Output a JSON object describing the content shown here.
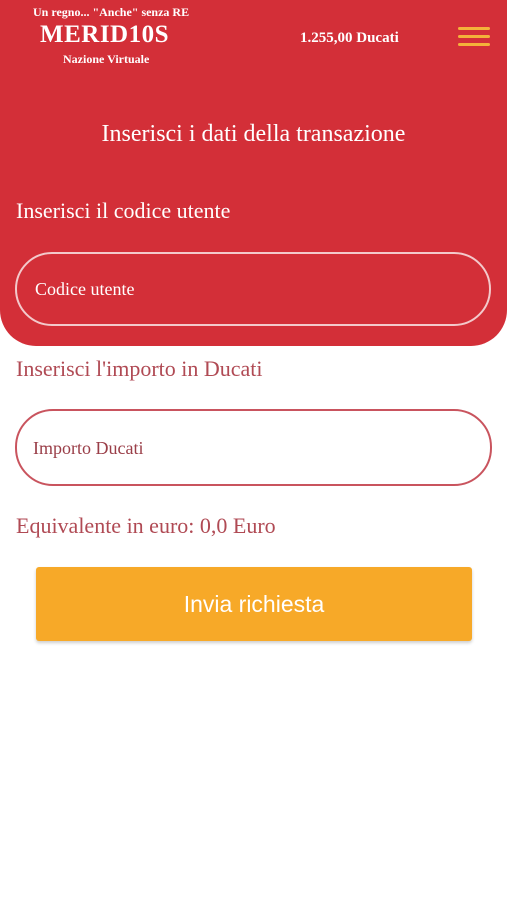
{
  "header": {
    "tagline": "Un regno... \"Anche\" senza RE",
    "logo": "MERID10S",
    "subtitle": "Nazione Virtuale",
    "balance": "1.255,00 Ducati",
    "menu_icon": "hamburger-menu-icon",
    "background_color": "#d32f38",
    "menu_icon_color": "#f4b23a"
  },
  "form": {
    "title": "Inserisci i dati della transazione",
    "user_code": {
      "label": "Inserisci il codice utente",
      "placeholder": "Codice utente",
      "value": ""
    },
    "amount": {
      "label": "Inserisci l'importo in Ducati",
      "placeholder": "Importo Ducati",
      "value": ""
    },
    "equivalent": "Equivalente in euro: 0,0 Euro",
    "submit_label": "Invia richiesta",
    "submit_color": "#f7a928"
  }
}
